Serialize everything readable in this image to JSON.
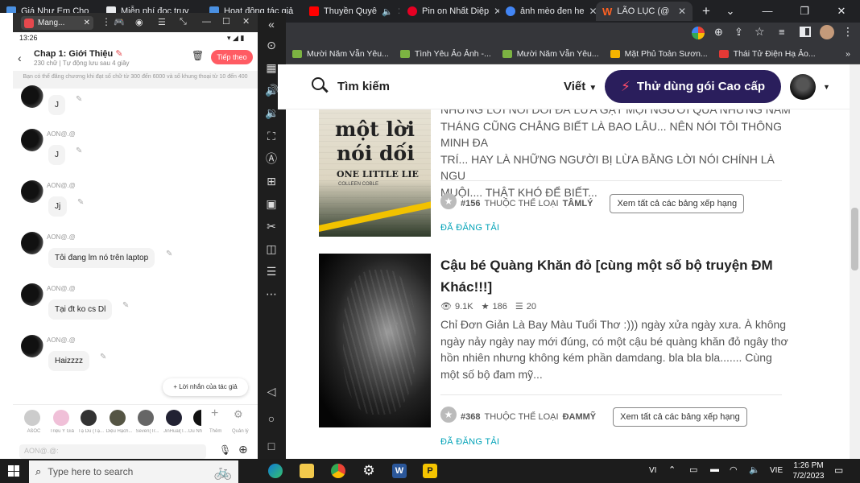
{
  "browser": {
    "tabs": [
      {
        "label": "Giá Như Em Chọ",
        "color": "#4a90e2"
      },
      {
        "label": "Miễn phí đọc truy",
        "color": "#e8eaed"
      },
      {
        "label": "Hoạt động tác giả",
        "color": "#4a90e2"
      },
      {
        "label": "Thuyền Quyê",
        "color": "#ff0000"
      },
      {
        "label": "Pin on Nhất Diệp",
        "color": "#e60023"
      },
      {
        "label": "ảnh mèo đen he",
        "color": "#4285f4"
      },
      {
        "label": "LÃO LỤC (@",
        "color": "#ff6122"
      }
    ],
    "new_tab": "+",
    "bookmarks": [
      "Mười Năm Vẫn Yêu...",
      "Tình Yêu Ảo Ảnh -...",
      "Mười Năm Vẫn Yêu...",
      "Mặt Phủ Toản Sươn...",
      "Thái Tử Điện Hạ Ảo..."
    ],
    "bookmark_more": "»"
  },
  "site": {
    "search_label": "Tìm kiếm",
    "write_label": "Viết",
    "premium_label": "Thử dùng gói Cao cấp",
    "stories": [
      {
        "desc_lines": [
          "NHỮNG LỜI NÓI DỐI ĐÃ LỪA GẠT MỌI NGƯỜI QUA NHỮNG NĂM",
          "THÁNG CŨNG CHẲNG BIẾT LÀ BAO LÂU... NÊN NÓI TÔI THÔNG MINH ĐA",
          "TRÍ... HAY LÀ NHỮNG NGƯỜI BỊ LỪA BẰNG LỜI NÓI CHÍNH LÀ NGU",
          "MUỘI.... THẬT KHÓ ĐỂ BIẾT..."
        ],
        "rank": "#156",
        "rank_text": "THUỘC THỂ LOẠI",
        "genre": "TÂMLÝ",
        "view_all": "Xem tất cả các bảng xếp hạng",
        "posted": "ĐÃ ĐĂNG TẢI",
        "cover_lines": [
          "một lời",
          "nói dối",
          "ONE LITTLE LIE",
          "COLLEEN COBLE"
        ]
      },
      {
        "title_lines": [
          "Cậu bé Quàng Khăn đỏ [cùng một số bộ truyện ĐM",
          "Khác!!!]"
        ],
        "views": "9.1K",
        "votes": "186",
        "parts": "20",
        "desc_lines": [
          "Chỉ Đơn Giản Là Bay Màu Tuổi Thơ :))) ngày xửa ngày xưa. À không",
          "ngày nảy ngày nay mới đúng, có một cậu bé quàng khăn đỏ ngây thơ",
          "hồn nhiên nhưng không kém phần damdang. bla bla bla....... Cùng",
          "một số bộ đam mỹ..."
        ],
        "rank": "#368",
        "rank_text": "THUỘC THỂ LOẠI",
        "genre": "ĐAMMỸ",
        "view_all": "Xem tất cả các bảng xếp hạng",
        "posted": "ĐÃ ĐĂNG TẢI"
      }
    ]
  },
  "emulator": {
    "tab_title": "Mang...",
    "status_time": "13:26",
    "chapter_title": "Chap 1: Giới Thiệu",
    "chapter_sub": "230 chữ | Tự động lưu sau 4 giây",
    "next_button": "Tiếp theo",
    "notice": "Bạn có thể đăng chương khi đạt số chữ từ 300 đến 6000 và số khung thoại từ 10 đến 400",
    "messages": [
      {
        "name": "",
        "text": "J"
      },
      {
        "name": "AON@.@",
        "text": "J"
      },
      {
        "name": "AON@.@",
        "text": "Jj"
      },
      {
        "name": "AON@.@",
        "text": "Tôi đang lm nó trên laptop"
      },
      {
        "name": "AON@.@",
        "text": "Tại đt ko cs Dl"
      },
      {
        "name": "AON@.@",
        "text": "Haizzzz"
      }
    ],
    "author_note_button": "+ Lời nhắn của tác giả",
    "characters": [
      "AßOC",
      "Triệu Y Giả",
      "Tạ Du (Tạ...",
      "Diệu Hạch...",
      "Seven(Tr...",
      "JinHual(T...",
      "Du Nh"
    ],
    "add_label": "Thêm",
    "manage_label": "Quản lý",
    "input_placeholder": "AON@.@:"
  },
  "taskbar": {
    "search_placeholder": "Type here to search",
    "lang": "VI",
    "ime": "VIE",
    "time": "1:26 PM",
    "date": "7/2/2023"
  }
}
